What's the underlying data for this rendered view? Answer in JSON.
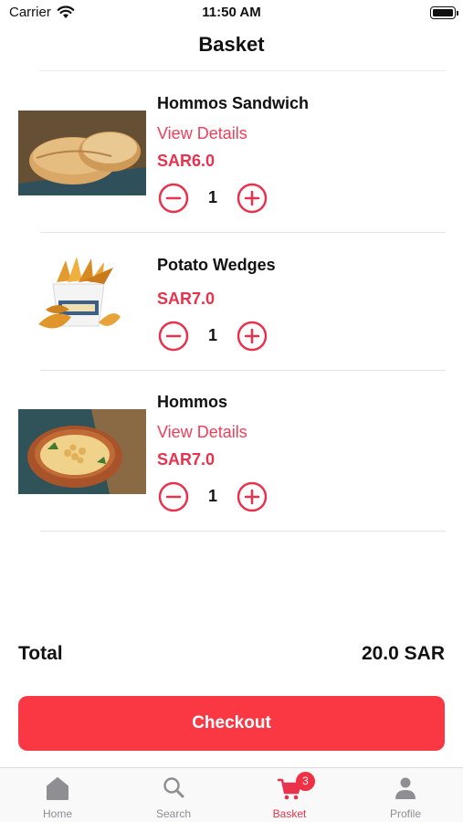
{
  "status_bar": {
    "carrier": "Carrier",
    "time": "11:50 AM"
  },
  "header": {
    "title": "Basket"
  },
  "items": [
    {
      "name": "Hommos Sandwich",
      "details_label": "View Details",
      "price": "SAR6.0",
      "quantity": "1"
    },
    {
      "name": "Potato Wedges",
      "price": "SAR7.0",
      "quantity": "1"
    },
    {
      "name": "Hommos",
      "details_label": "View Details",
      "price": "SAR7.0",
      "quantity": "1"
    }
  ],
  "summary": {
    "total_label": "Total",
    "total_value": "20.0 SAR"
  },
  "checkout": {
    "label": "Checkout"
  },
  "tabbar": {
    "tabs": [
      {
        "label": "Home",
        "icon": "home-icon"
      },
      {
        "label": "Search",
        "icon": "search-icon"
      },
      {
        "label": "Basket",
        "icon": "cart-icon",
        "badge": "3",
        "active": true
      },
      {
        "label": "Profile",
        "icon": "person-icon"
      }
    ]
  },
  "colors": {
    "accent": "#fa3844",
    "price": "#e8324e",
    "link": "#f03e5a",
    "inactive": "#8e8e93"
  }
}
